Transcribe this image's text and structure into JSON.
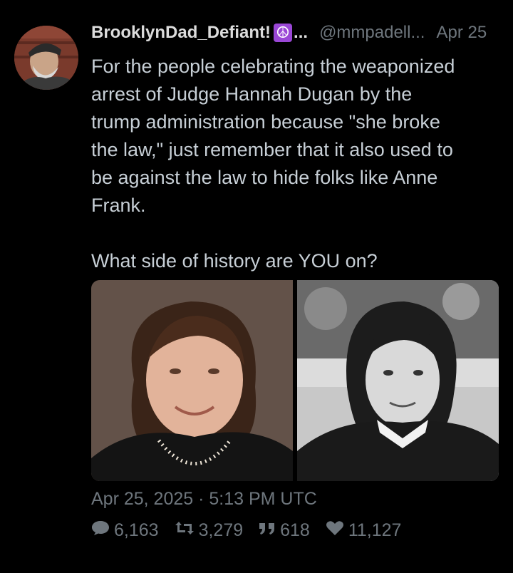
{
  "tweet": {
    "display_name": "BrooklynDad_Defiant!",
    "display_name_emoji": "☮",
    "display_name_truncation": "...",
    "handle": "@mmpadell...",
    "date": "Apr 25",
    "text": "For the people celebrating the weaponized\narrest of Judge Hannah Dugan by the\ntrump administration because \"she broke\nthe law,\" just remember that it also used to\nbe against the law to hide folks like Anne\nFrank.\n\nWhat side of history are YOU on?",
    "timestamp": "Apr 25, 2025 · 5:13 PM UTC",
    "stats": {
      "replies": "6,163",
      "retweets": "3,279",
      "quotes": "618",
      "likes": "11,127"
    },
    "media": [
      {
        "icon": "photo-woman-color"
      },
      {
        "icon": "photo-girl-bw"
      }
    ]
  },
  "colors": {
    "background": "#000000",
    "text": "#c7cfd6",
    "muted": "#6e767d",
    "emoji_bg": "#9a47d6"
  }
}
